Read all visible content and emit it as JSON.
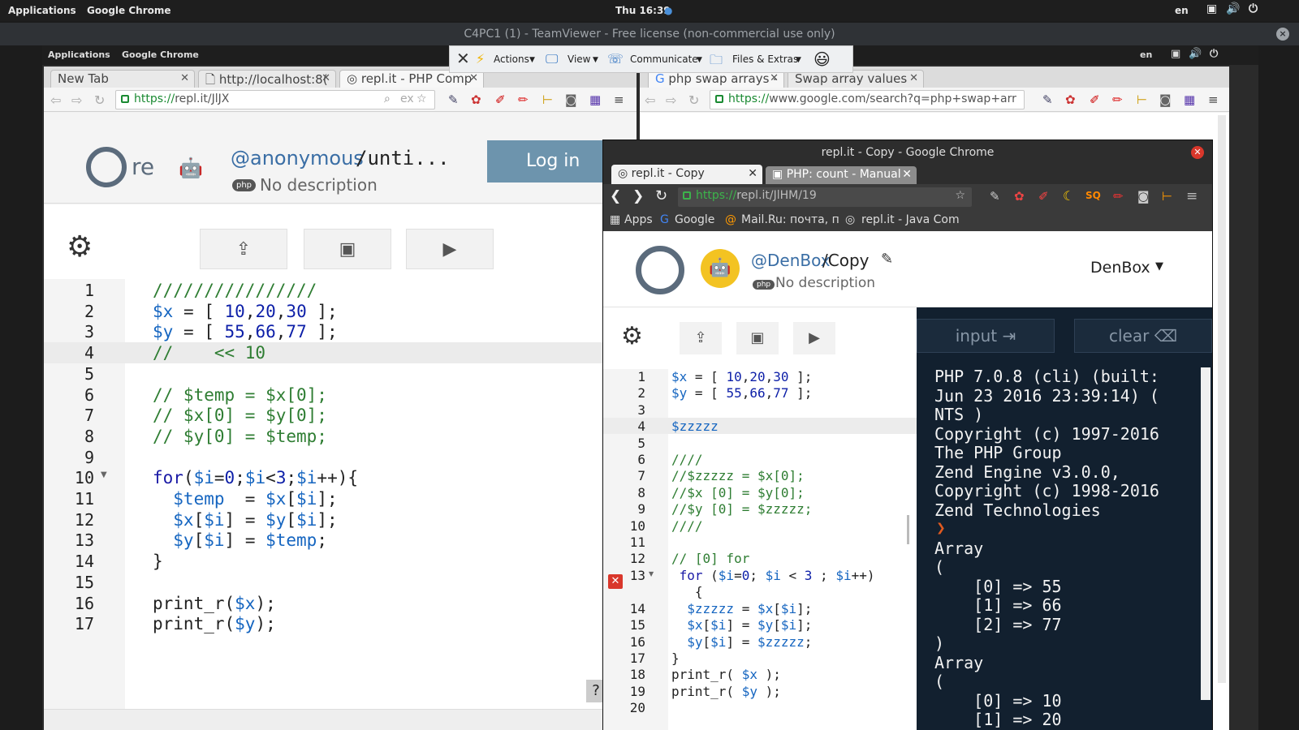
{
  "top_bar": {
    "applications": "Applications",
    "app": "Google Chrome",
    "clock": "Thu 16:39",
    "lang": "en"
  },
  "teamviewer": {
    "title": "C4PC1 (1) - TeamViewer - Free license (non-commercial use only)",
    "toolbar": {
      "actions": "Actions",
      "view": "View",
      "communicate": "Communicate",
      "files": "Files & Extras"
    }
  },
  "remote_top": {
    "applications": "Applications",
    "app": "Google Chrome",
    "lang": "en"
  },
  "left_browser": {
    "tabs": [
      {
        "label": "New Tab"
      },
      {
        "label": "http://localhost:8("
      },
      {
        "label": "repl.it - PHP Comp"
      }
    ],
    "url_https": "https://",
    "url_rest": "repl.it/JlJX",
    "url_hint": "ex",
    "user": "@anonymous",
    "project": "/unti...",
    "desc": "No description",
    "login": "Log in",
    "lang_badge": "php",
    "logo_text": "re",
    "help": "?",
    "lines": [
      "1",
      "2",
      "3",
      "4",
      "5",
      "6",
      "7",
      "8",
      "9",
      "10",
      "11",
      "12",
      "13",
      "14",
      "15",
      "16",
      "17"
    ],
    "code": [
      [
        {
          "t": "////////////////",
          "c": "cm"
        }
      ],
      [
        {
          "t": "$x",
          "c": "vr"
        },
        {
          "t": " = [ ",
          "c": "pn"
        },
        {
          "t": "10",
          "c": "nm"
        },
        {
          "t": ",",
          "c": "pn"
        },
        {
          "t": "20",
          "c": "nm"
        },
        {
          "t": ",",
          "c": "pn"
        },
        {
          "t": "30",
          "c": "nm"
        },
        {
          "t": " ];",
          "c": "pn"
        }
      ],
      [
        {
          "t": "$y",
          "c": "vr"
        },
        {
          "t": " = [ ",
          "c": "pn"
        },
        {
          "t": "55",
          "c": "nm"
        },
        {
          "t": ",",
          "c": "pn"
        },
        {
          "t": "66",
          "c": "nm"
        },
        {
          "t": ",",
          "c": "pn"
        },
        {
          "t": "77",
          "c": "nm"
        },
        {
          "t": " ];",
          "c": "pn"
        }
      ],
      [
        {
          "t": "//    << 10",
          "c": "cm"
        }
      ],
      [],
      [
        {
          "t": "// $temp = $x[0];",
          "c": "cm"
        }
      ],
      [
        {
          "t": "// $x[0] = $y[0];",
          "c": "cm"
        }
      ],
      [
        {
          "t": "// $y[0] = $temp;",
          "c": "cm"
        }
      ],
      [],
      [
        {
          "t": "for",
          "c": "kw"
        },
        {
          "t": "(",
          "c": "pn"
        },
        {
          "t": "$i",
          "c": "vr"
        },
        {
          "t": "=",
          "c": "pn"
        },
        {
          "t": "0",
          "c": "nm"
        },
        {
          "t": ";",
          "c": "pn"
        },
        {
          "t": "$i",
          "c": "vr"
        },
        {
          "t": "<",
          "c": "pn"
        },
        {
          "t": "3",
          "c": "nm"
        },
        {
          "t": ";",
          "c": "pn"
        },
        {
          "t": "$i",
          "c": "vr"
        },
        {
          "t": "++){",
          "c": "pn"
        }
      ],
      [
        {
          "t": "  $temp",
          "c": "vr"
        },
        {
          "t": "  = ",
          "c": "pn"
        },
        {
          "t": "$x",
          "c": "vr"
        },
        {
          "t": "[",
          "c": "pn"
        },
        {
          "t": "$i",
          "c": "vr"
        },
        {
          "t": "];",
          "c": "pn"
        }
      ],
      [
        {
          "t": "  $x",
          "c": "vr"
        },
        {
          "t": "[",
          "c": "pn"
        },
        {
          "t": "$i",
          "c": "vr"
        },
        {
          "t": "] = ",
          "c": "pn"
        },
        {
          "t": "$y",
          "c": "vr"
        },
        {
          "t": "[",
          "c": "pn"
        },
        {
          "t": "$i",
          "c": "vr"
        },
        {
          "t": "];",
          "c": "pn"
        }
      ],
      [
        {
          "t": "  $y",
          "c": "vr"
        },
        {
          "t": "[",
          "c": "pn"
        },
        {
          "t": "$i",
          "c": "vr"
        },
        {
          "t": "] = ",
          "c": "pn"
        },
        {
          "t": "$temp",
          "c": "vr"
        },
        {
          "t": ";",
          "c": "pn"
        }
      ],
      [
        {
          "t": "}",
          "c": "pn"
        }
      ],
      [],
      [
        {
          "t": "print_r(",
          "c": "pn"
        },
        {
          "t": "$x",
          "c": "vr"
        },
        {
          "t": ");",
          "c": "pn"
        }
      ],
      [
        {
          "t": "print_r(",
          "c": "pn"
        },
        {
          "t": "$y",
          "c": "vr"
        },
        {
          "t": ");",
          "c": "pn"
        }
      ]
    ]
  },
  "middle_browser": {
    "tabs": [
      {
        "label": "php swap arrays -"
      },
      {
        "label": "Swap array values"
      }
    ],
    "url_https": "https://",
    "url_rest": "www.google.com/search?q=php+swap+arr"
  },
  "right_browser": {
    "title": "repl.it - Copy - Google Chrome",
    "tabs": [
      {
        "label": "repl.it - Copy"
      },
      {
        "label": "PHP: count - Manual"
      }
    ],
    "url_https": "https://",
    "url_rest": "repl.it/JlHM/19",
    "bookmarks": [
      "Apps",
      "Google",
      "Mail.Ru: почта, п",
      "repl.it - Java Com"
    ],
    "user": "@DenBox",
    "project": "/Copy",
    "desc": "No description",
    "lang_badge": "php",
    "account": "DenBox",
    "input_btn": "input",
    "clear_btn": "clear",
    "lines": [
      "1",
      "2",
      "3",
      "4",
      "5",
      "6",
      "7",
      "8",
      "9",
      "10",
      "11",
      "12",
      "13",
      "",
      "14",
      "15",
      "16",
      "17",
      "18",
      "19",
      "20"
    ],
    "code": [
      [
        {
          "t": "$x",
          "c": "vr"
        },
        {
          "t": " = [ ",
          "c": "pn"
        },
        {
          "t": "10",
          "c": "nm"
        },
        {
          "t": ",",
          "c": "pn"
        },
        {
          "t": "20",
          "c": "nm"
        },
        {
          "t": ",",
          "c": "pn"
        },
        {
          "t": "30",
          "c": "nm"
        },
        {
          "t": " ];",
          "c": "pn"
        }
      ],
      [
        {
          "t": "$y",
          "c": "vr"
        },
        {
          "t": " = [ ",
          "c": "pn"
        },
        {
          "t": "55",
          "c": "nm"
        },
        {
          "t": ",",
          "c": "pn"
        },
        {
          "t": "66",
          "c": "nm"
        },
        {
          "t": ",",
          "c": "pn"
        },
        {
          "t": "77",
          "c": "nm"
        },
        {
          "t": " ];",
          "c": "pn"
        }
      ],
      [],
      [
        {
          "t": "$zzzzz",
          "c": "vr"
        }
      ],
      [],
      [
        {
          "t": "////",
          "c": "cm"
        }
      ],
      [
        {
          "t": "//$zzzzz = $x[0];",
          "c": "cm"
        }
      ],
      [
        {
          "t": "//$x [0] = $y[0];",
          "c": "cm"
        }
      ],
      [
        {
          "t": "//$y [0] = $zzzzz;",
          "c": "cm"
        }
      ],
      [
        {
          "t": "////",
          "c": "cm"
        }
      ],
      [],
      [
        {
          "t": "// [0] for",
          "c": "cm"
        }
      ],
      [
        {
          "t": " for",
          "c": "kw"
        },
        {
          "t": " (",
          "c": "pn"
        },
        {
          "t": "$i",
          "c": "vr"
        },
        {
          "t": "=",
          "c": "pn"
        },
        {
          "t": "0",
          "c": "nm"
        },
        {
          "t": "; ",
          "c": "pn"
        },
        {
          "t": "$i",
          "c": "vr"
        },
        {
          "t": " < ",
          "c": "pn"
        },
        {
          "t": "3",
          "c": "nm"
        },
        {
          "t": " ; ",
          "c": "pn"
        },
        {
          "t": "$i",
          "c": "vr"
        },
        {
          "t": "++)",
          "c": "pn"
        }
      ],
      [
        {
          "t": "   {",
          "c": "pn"
        }
      ],
      [
        {
          "t": "  $zzzzz",
          "c": "vr"
        },
        {
          "t": " = ",
          "c": "pn"
        },
        {
          "t": "$x",
          "c": "vr"
        },
        {
          "t": "[",
          "c": "pn"
        },
        {
          "t": "$i",
          "c": "vr"
        },
        {
          "t": "];",
          "c": "pn"
        }
      ],
      [
        {
          "t": "  $x",
          "c": "vr"
        },
        {
          "t": "[",
          "c": "pn"
        },
        {
          "t": "$i",
          "c": "vr"
        },
        {
          "t": "] = ",
          "c": "pn"
        },
        {
          "t": "$y",
          "c": "vr"
        },
        {
          "t": "[",
          "c": "pn"
        },
        {
          "t": "$i",
          "c": "vr"
        },
        {
          "t": "];",
          "c": "pn"
        }
      ],
      [
        {
          "t": "  $y",
          "c": "vr"
        },
        {
          "t": "[",
          "c": "pn"
        },
        {
          "t": "$i",
          "c": "vr"
        },
        {
          "t": "] = ",
          "c": "pn"
        },
        {
          "t": "$zzzzz",
          "c": "vr"
        },
        {
          "t": ";",
          "c": "pn"
        }
      ],
      [
        {
          "t": "}",
          "c": "pn"
        }
      ],
      [
        {
          "t": "print_r( ",
          "c": "pn"
        },
        {
          "t": "$x",
          "c": "vr"
        },
        {
          "t": " );",
          "c": "pn"
        }
      ],
      [
        {
          "t": "print_r( ",
          "c": "pn"
        },
        {
          "t": "$y",
          "c": "vr"
        },
        {
          "t": " );",
          "c": "pn"
        }
      ],
      []
    ],
    "output": [
      "PHP 7.0.8 (cli) (built:",
      "Jun 23 2016 23:39:14) (",
      "NTS )",
      "Copyright (c) 1997-2016",
      "The PHP Group",
      "Zend Engine v3.0.0,",
      "Copyright (c) 1998-2016",
      "Zend Technologies",
      "",
      "Array",
      "(",
      "    [0] => 55",
      "    [1] => 66",
      "    [2] => 77",
      ")",
      "Array",
      "(",
      "    [0] => 10",
      "    [1] => 20"
    ]
  },
  "colors": {
    "accent_green": "#1a8a32",
    "login_bg": "#6d94ad",
    "terminal_bg": "#12202f",
    "error_red": "#d9372b"
  }
}
